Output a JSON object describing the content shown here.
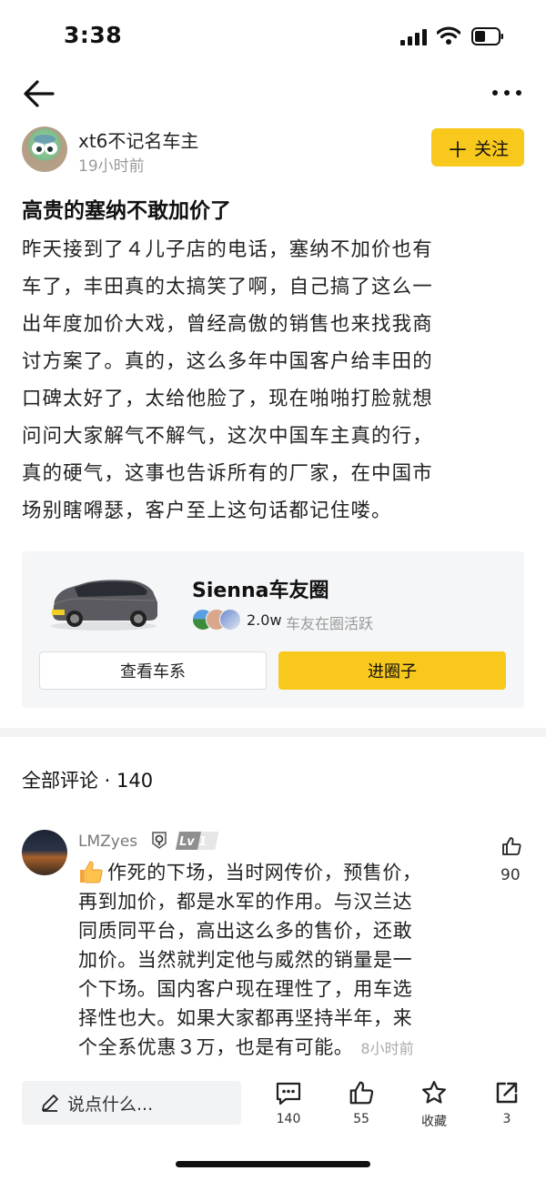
{
  "status_bar": {
    "time": "3:38"
  },
  "author": {
    "name": "xt6不记名车主",
    "time": "19小时前"
  },
  "follow_button": {
    "label": "关注"
  },
  "post": {
    "title": "高贵的塞纳不敢加价了",
    "lines": [
      "昨天接到了４儿子店的电话，塞纳不加价也有",
      "车了，丰田真的太搞笑了啊，自己搞了这么一",
      "出年度加价大戏，曾经高傲的销售也来找我商",
      "讨方案了。真的，这么多年中国客户给丰田的",
      "口碑太好了，太给他脸了，现在啪啪打脸就想",
      "问问大家解气不解气，这次中国车主真的行，",
      "真的硬气，这事也告诉所有的厂家，在中国市",
      "场别瞎嘚瑟，客户至上这句话都记住喽。"
    ]
  },
  "circle": {
    "name": "Sienna车友圈",
    "member_count": "2.0w",
    "active_text": "车友在圈活跃",
    "btn_series": "查看车系",
    "btn_enter": "进圈子"
  },
  "comments_header": "全部评论 · 140",
  "comment": {
    "user": "LMZyes",
    "level": "Lv 1",
    "likes": "90",
    "lines": [
      "作死的下场，当时网传价，预售价，",
      "再到加价，都是水军的作用。与汉兰达",
      "同质同平台，高出这么多的售价，还敢",
      "加价。当然就判定他与威然的销量是一",
      "个下场。国内客户现在理性了，用车选",
      "择性也大。如果大家都再坚持半年，来",
      "个全系优惠３万，也是有可能。"
    ],
    "time": "8小时前"
  },
  "bottom_bar": {
    "input_placeholder": "说点什么...",
    "comment_count": "140",
    "like_count": "55",
    "favorite_label": "收藏",
    "share_count": "3"
  },
  "colors": {
    "accent": "#f8c81c",
    "card_bg": "#f5f6f8"
  }
}
